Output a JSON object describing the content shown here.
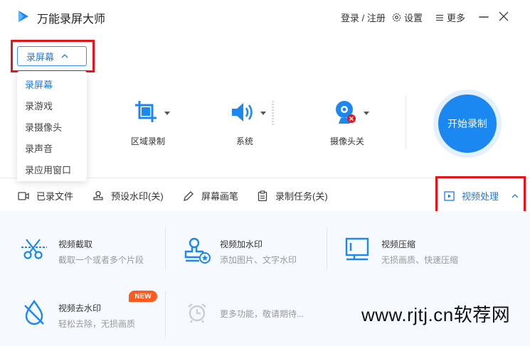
{
  "app": {
    "title": "万能录屏大师"
  },
  "titlebar": {
    "login": "登录 / 注册",
    "settings": "设置",
    "more": "更多"
  },
  "mode": {
    "selected": "录屏幕",
    "options": [
      "录屏幕",
      "录游戏",
      "录摄像头",
      "录声音",
      "录应用窗口"
    ]
  },
  "tools": {
    "region": "区域录制",
    "audio": "系统",
    "camera": "摄像头关"
  },
  "record": {
    "label": "开始录制"
  },
  "bottom_bar": {
    "recorded_files": "已录文件",
    "watermark_preset": "预设水印(关)",
    "screen_brush": "屏幕画笔",
    "record_task": "录制任务(关)",
    "video_process": "视频处理"
  },
  "video_tools": [
    {
      "title": "视频截取",
      "subtitle": "截取一个或者多个片段"
    },
    {
      "title": "视频加水印",
      "subtitle": "添加图片、文字水印"
    },
    {
      "title": "视频压缩",
      "subtitle": "无损画质、快速压缩"
    },
    {
      "title": "视频去水印",
      "subtitle": "轻松去除，无损画质"
    }
  ],
  "more_features": "更多功能，敬请期待...",
  "badge": "NEW",
  "watermark_text": "www.rjtj.cn软荐网",
  "colors": {
    "accent": "#1b87f0",
    "highlight_box": "#e8141c",
    "badge": "#ff5a1f"
  }
}
